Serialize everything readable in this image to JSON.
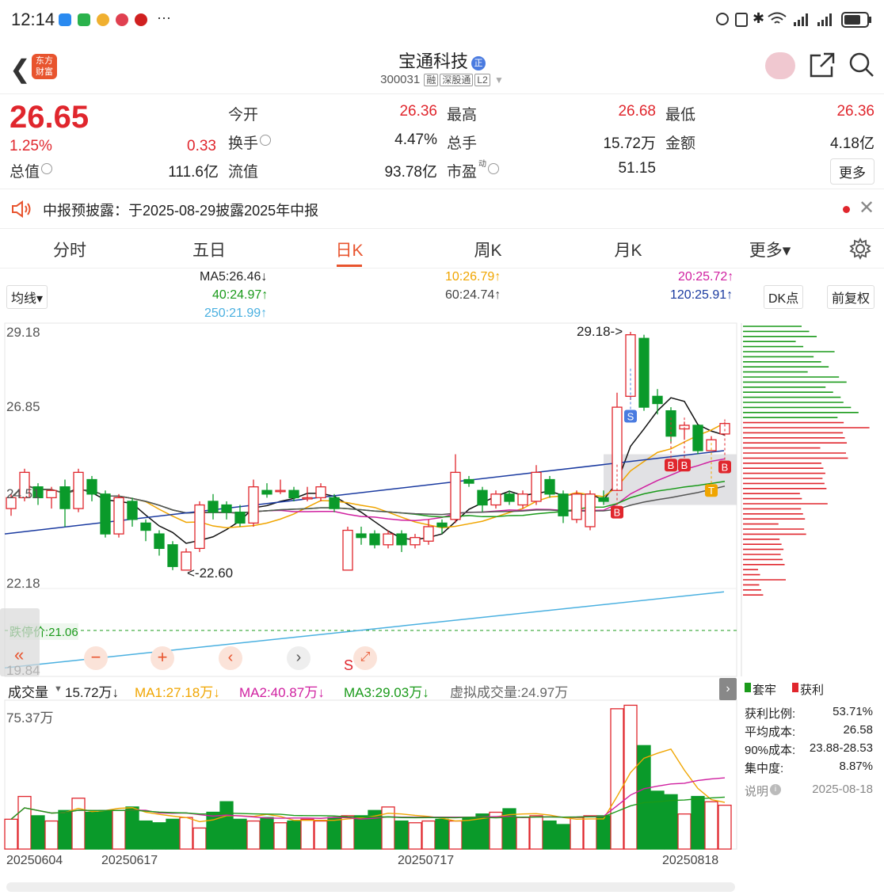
{
  "status": {
    "time": "12:14",
    "more": "···"
  },
  "header": {
    "logo": "东方财富",
    "stock_name": "宝通科技",
    "badge": "正",
    "code": "300031",
    "tags": [
      "融",
      "深股通",
      "L2"
    ]
  },
  "quote": {
    "price": "26.65",
    "pct": "1.25%",
    "change": "0.33",
    "rows": [
      [
        {
          "label": "今开",
          "value": "26.36",
          "red": true
        },
        {
          "label": "最高",
          "value": "26.68",
          "red": true
        },
        {
          "label": "最低",
          "value": "26.36",
          "red": true
        }
      ],
      [
        {
          "label": "换手",
          "value": "4.47%",
          "red": false
        },
        {
          "label": "总手",
          "value": "15.72万",
          "red": false
        },
        {
          "label": "金额",
          "value": "4.18亿",
          "red": false
        }
      ],
      [
        {
          "label": "流值",
          "value": "93.78亿",
          "red": false
        },
        {
          "label": "市盈",
          "value": "51.15",
          "red": false
        }
      ]
    ],
    "total_label": "总值",
    "total_value": "111.6亿",
    "more": "更多"
  },
  "notice": {
    "text": "中报预披露：于2025-08-29披露2025年中报"
  },
  "tabs": [
    "分时",
    "五日",
    "日K",
    "周K",
    "月K",
    "更多▾"
  ],
  "ma_bar": {
    "selector": "均线▾",
    "ma5": "MA5:26.46↓",
    "ma10": "10:26.79↑",
    "ma20": "20:25.72↑",
    "ma40": "40:24.97↑",
    "ma60": "60:24.74↑",
    "ma120": "120:25.91↑",
    "ma250": "250:21.99↑",
    "dk": "DK点",
    "fq": "前复权"
  },
  "chart_data": {
    "type": "candlestick",
    "y_labels": [
      "29.18",
      "26.85",
      "24.51",
      "22.18",
      "19.84"
    ],
    "ylim": [
      19.84,
      29.18
    ],
    "high_label": "29.18->",
    "low_label": "<-22.60",
    "limit_down": "跌停价:21.06",
    "candles": [
      [
        24.3,
        24.6,
        24.1,
        24.7
      ],
      [
        24.6,
        25.3,
        24.5,
        25.4
      ],
      [
        24.9,
        24.6,
        24.4,
        25.0
      ],
      [
        24.6,
        24.8,
        24.3,
        24.9
      ],
      [
        24.9,
        24.3,
        23.8,
        25.1
      ],
      [
        24.3,
        25.3,
        24.2,
        25.4
      ],
      [
        25.1,
        24.7,
        24.5,
        25.2
      ],
      [
        24.7,
        23.6,
        23.5,
        24.8
      ],
      [
        23.6,
        24.6,
        23.5,
        24.7
      ],
      [
        24.5,
        24.0,
        23.8,
        24.6
      ],
      [
        23.9,
        23.7,
        23.4,
        24.0
      ],
      [
        23.6,
        23.2,
        23.0,
        23.7
      ],
      [
        23.3,
        22.7,
        22.6,
        23.4
      ],
      [
        22.6,
        23.1,
        22.6,
        23.2
      ],
      [
        23.2,
        24.4,
        23.1,
        24.5
      ],
      [
        24.5,
        24.2,
        24.0,
        24.7
      ],
      [
        24.4,
        24.2,
        24.0,
        24.5
      ],
      [
        24.2,
        23.9,
        23.8,
        24.4
      ],
      [
        23.9,
        24.9,
        23.8,
        25.1
      ],
      [
        24.8,
        24.7,
        24.6,
        25.0
      ],
      [
        24.8,
        24.8,
        24.7,
        25.1
      ],
      [
        24.8,
        24.6,
        24.5,
        24.9
      ],
      [
        24.6,
        24.6,
        24.5,
        24.9
      ],
      [
        24.6,
        24.9,
        24.5,
        25.0
      ],
      [
        24.6,
        24.3,
        24.2,
        24.7
      ],
      [
        22.6,
        23.7,
        22.6,
        23.8
      ],
      [
        23.6,
        23.5,
        23.3,
        23.8
      ],
      [
        23.6,
        23.3,
        23.2,
        23.7
      ],
      [
        23.3,
        23.6,
        23.2,
        23.7
      ],
      [
        23.6,
        23.3,
        23.1,
        23.7
      ],
      [
        23.3,
        23.5,
        23.2,
        23.6
      ],
      [
        23.4,
        23.8,
        23.3,
        24.0
      ],
      [
        23.9,
        23.8,
        23.6,
        24.0
      ],
      [
        24.0,
        25.3,
        23.9,
        25.8
      ],
      [
        25.1,
        25.0,
        24.9,
        25.2
      ],
      [
        24.8,
        24.4,
        24.2,
        24.9
      ],
      [
        24.4,
        24.7,
        24.3,
        24.8
      ],
      [
        24.7,
        24.5,
        24.4,
        24.8
      ],
      [
        24.4,
        24.7,
        24.3,
        24.8
      ],
      [
        24.5,
        25.3,
        24.4,
        25.5
      ],
      [
        25.1,
        24.7,
        24.6,
        25.2
      ],
      [
        24.7,
        24.1,
        23.9,
        24.8
      ],
      [
        24.0,
        24.7,
        23.9,
        24.8
      ],
      [
        23.8,
        24.7,
        23.7,
        24.8
      ],
      [
        24.6,
        24.5,
        24.4,
        24.8
      ],
      [
        24.8,
        27.1,
        24.8,
        27.5
      ],
      [
        27.4,
        29.1,
        27.3,
        29.18
      ],
      [
        29.0,
        27.1,
        27.0,
        29.1
      ],
      [
        27.4,
        27.2,
        26.9,
        27.6
      ],
      [
        27.0,
        26.3,
        26.1,
        27.1
      ],
      [
        26.5,
        26.6,
        26.2,
        26.7
      ],
      [
        26.6,
        25.9,
        25.8,
        26.6
      ],
      [
        25.9,
        26.2,
        25.9,
        26.3
      ],
      [
        26.36,
        26.65,
        26.36,
        26.68
      ]
    ],
    "signals": [
      "S",
      "B",
      "B",
      "B",
      "T",
      "B"
    ],
    "volume_label": "成交量",
    "volume": "15.72万↓",
    "ma1": "MA1:27.18万↓",
    "ma2": "MA2:40.87万↓",
    "ma3": "MA3:29.03万↓",
    "virtual": "虚拟成交量:24.97万",
    "vol_max": "75.37万",
    "volumes": [
      17,
      30,
      19,
      16,
      22,
      29,
      21,
      22,
      22,
      24,
      16,
      15,
      17,
      18,
      12,
      21,
      27,
      17,
      16,
      18,
      15,
      16,
      17,
      16,
      18,
      19,
      19,
      22,
      24,
      16,
      15,
      16,
      17,
      16,
      18,
      20,
      21,
      23,
      18,
      19,
      16,
      14,
      18,
      19,
      19,
      80,
      82,
      59,
      33,
      31,
      20,
      30,
      27,
      25
    ],
    "dates": [
      "20250604",
      "20250617",
      "20250717",
      "20250818"
    ],
    "legend": {
      "hold": "套牢",
      "profit": "获利"
    }
  },
  "chip_stats": [
    {
      "label": "获利比例:",
      "value": "53.71%"
    },
    {
      "label": "平均成本:",
      "value": "26.58"
    },
    {
      "label": "90%成本:",
      "value": "23.88-28.53"
    },
    {
      "label": "集中度:",
      "value": "8.87%"
    }
  ],
  "chip_note": {
    "label": "说明",
    "date": "2025-08-18"
  },
  "colors": {
    "up": "#e0262d",
    "down": "#0a9a2a",
    "accent": "#e8542e"
  }
}
